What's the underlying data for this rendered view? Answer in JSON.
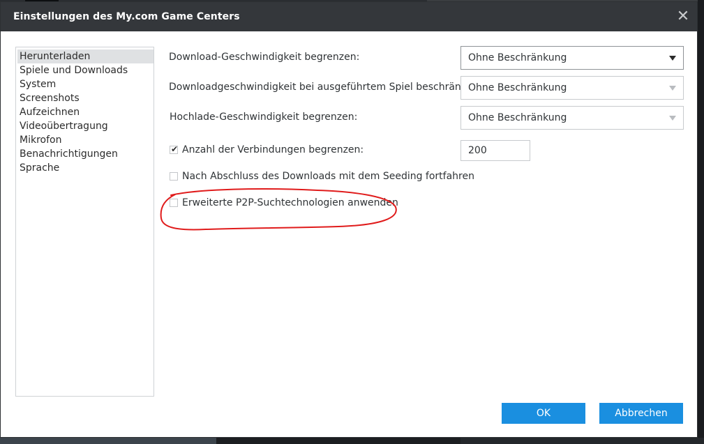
{
  "window": {
    "title": "Einstellungen des My.com Game Centers",
    "close_glyph": "✕"
  },
  "nav": {
    "items": [
      {
        "label": "Herunterladen",
        "active": true
      },
      {
        "label": "Spiele und Downloads"
      },
      {
        "label": "System"
      },
      {
        "label": "Screenshots"
      },
      {
        "label": "Aufzeichnen"
      },
      {
        "label": "Videoübertragung"
      },
      {
        "label": "Mikrofon"
      },
      {
        "label": "Benachrichtigungen"
      },
      {
        "label": "Sprache"
      }
    ]
  },
  "settings": {
    "download_limit": {
      "label": "Download-Geschwindigkeit begrenzen:",
      "value": "Ohne Beschränkung"
    },
    "ingame_limit": {
      "label": "Downloadgeschwindigkeit bei ausgeführtem Spiel beschränken:",
      "value": "Ohne Beschränkung"
    },
    "upload_limit": {
      "label": "Hochlade-Geschwindigkeit begrenzen:",
      "value": "Ohne Beschränkung"
    },
    "connections": {
      "label": "Anzahl der Verbindungen begrenzen:",
      "checked": true,
      "value": "200",
      "check_glyph": "✔"
    },
    "seeding": {
      "label": "Nach Abschluss des Downloads mit dem Seeding fortfahren",
      "checked": false
    },
    "p2p": {
      "label": "Erweiterte P2P-Suchtechnologien anwenden",
      "checked": false
    }
  },
  "buttons": {
    "ok": "OK",
    "cancel": "Abbrechen"
  },
  "colors": {
    "titlebar": "#34373b",
    "primary_button": "#1a8fe0",
    "annotation": "#e01b1b"
  },
  "icons": {
    "close": "close-icon",
    "dropdown": "chevron-down-icon",
    "check": "checkmark-icon"
  }
}
